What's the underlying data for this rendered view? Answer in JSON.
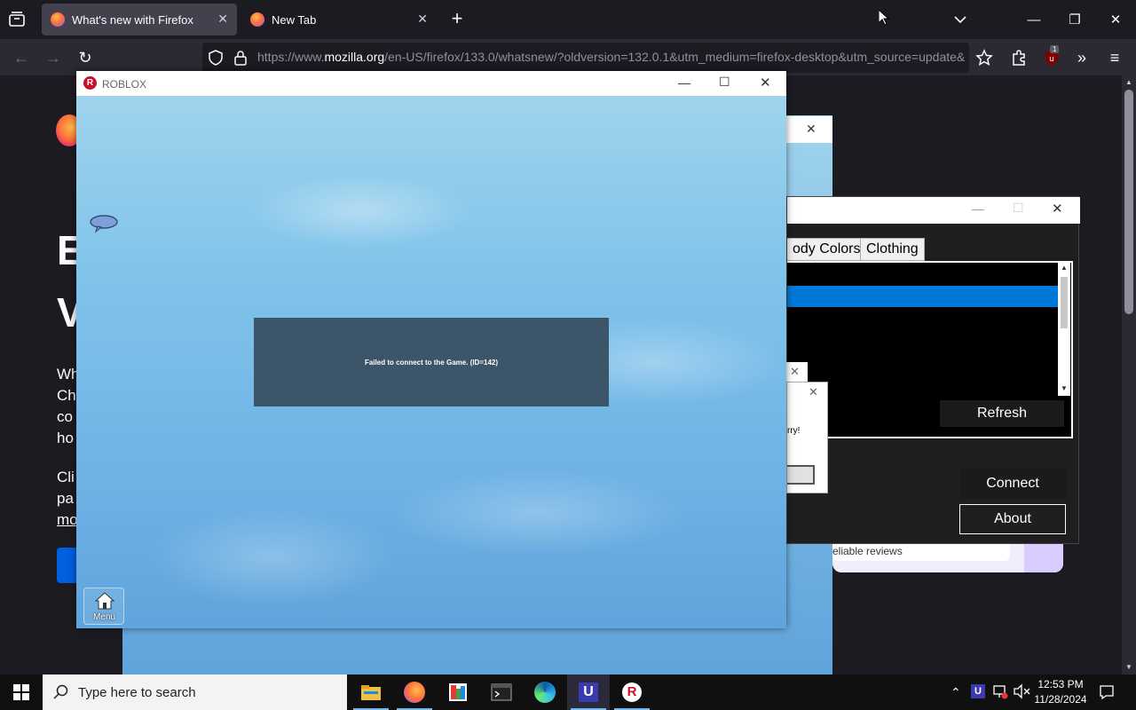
{
  "browser": {
    "tabs": [
      {
        "title": "What's new with Firefox",
        "active": true
      },
      {
        "title": "New Tab",
        "active": false
      }
    ],
    "url_prefix": "https://www.",
    "url_domain": "mozilla.org",
    "url_rest": "/en-US/firefox/133.0/whatsnew/?oldversion=132.0.1&utm_medium=firefox-desktop&utm_source=update&",
    "addon_badge": "1"
  },
  "page_behind": {
    "heading_partial_1": "E",
    "heading_partial_2": "V",
    "para_lines": [
      "Wh",
      "Ch",
      "co",
      "ho"
    ],
    "para2_lines": [
      "Cli",
      "pa",
      "mo"
    ],
    "review_text": "eliable reviews"
  },
  "dark_app": {
    "tab_body_colors": "ody Colors",
    "tab_clothing": "Clothing",
    "refresh_label": "Refresh",
    "connect_label": "Connect",
    "about_label": "About"
  },
  "small_dialog": {
    "text": "rry!"
  },
  "roblox": {
    "title": "ROBLOX",
    "error_message": "Failed to connect to the Game. (ID=142)",
    "menu_label": "Menu"
  },
  "taskbar": {
    "search_placeholder": "Type here to search",
    "time": "12:53 PM",
    "date": "11/28/2024"
  },
  "colors": {
    "firefox_bg": "#1c1b22",
    "toolbar": "#2b2a33",
    "list_selection": "#0078d7",
    "error_box": "#3d5568"
  }
}
